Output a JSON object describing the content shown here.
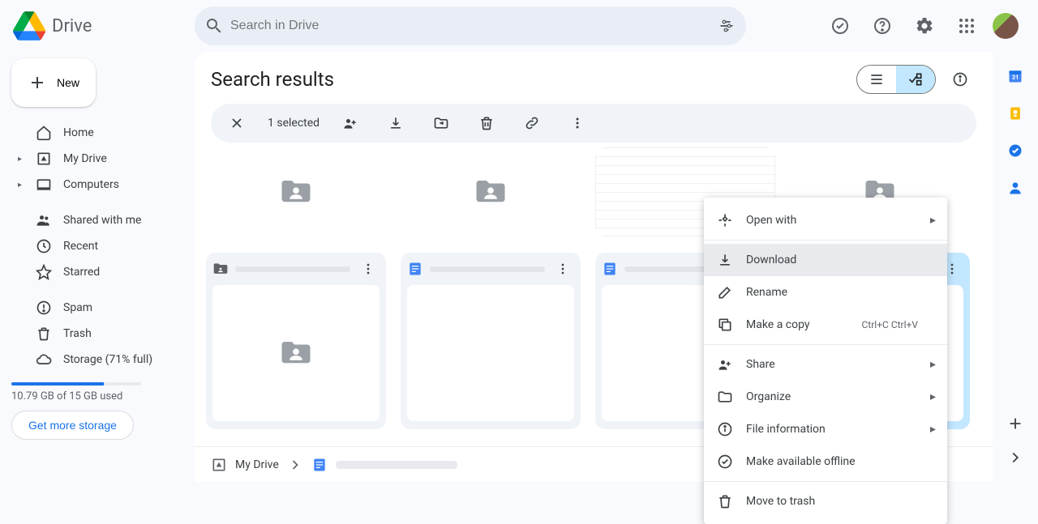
{
  "app": {
    "title": "Drive"
  },
  "search": {
    "placeholder": "Search in Drive"
  },
  "sidebar": {
    "new_label": "New",
    "items": {
      "home": "Home",
      "my_drive": "My Drive",
      "computers": "Computers",
      "shared": "Shared with me",
      "recent": "Recent",
      "starred": "Starred",
      "spam": "Spam",
      "trash": "Trash",
      "storage": "Storage (71% full)"
    },
    "storage_used": "10.79 GB of 15 GB used",
    "more_storage": "Get more storage"
  },
  "content": {
    "title": "Search results",
    "selection": {
      "count_label": "1 selected"
    }
  },
  "path": {
    "root": "My Drive"
  },
  "context_menu": {
    "open_with": "Open with",
    "download": "Download",
    "rename": "Rename",
    "make_copy": "Make a copy",
    "make_copy_kbd": "Ctrl+C Ctrl+V",
    "share": "Share",
    "organize": "Organize",
    "file_info": "File information",
    "offline": "Make available offline",
    "trash": "Move to trash"
  }
}
